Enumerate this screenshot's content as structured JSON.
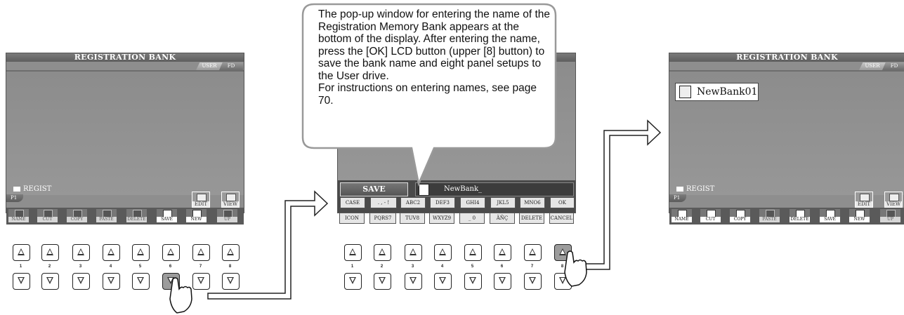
{
  "left_screen": {
    "title": "REGISTRATION BANK",
    "tabs": [
      "USER",
      "FD"
    ],
    "active_tab": "USER",
    "folder": "REGIST",
    "page": "P1",
    "side_buttons": [
      "EDIT",
      "VIEW"
    ],
    "function_buttons": [
      "NAME",
      "CUT",
      "COPY",
      "PASTE",
      "DELETE",
      "SAVE",
      "NEW",
      "UP"
    ],
    "highlighted": "SAVE"
  },
  "middle_screen": {
    "save_label": "SAVE",
    "name_value": "NewBank_",
    "keys_top": [
      "CASE",
      ". , - !",
      "ABC2",
      "DEF3",
      "GHI4",
      "JKL5",
      "MNO6",
      "OK"
    ],
    "keys_bottom": [
      "ICON",
      "PQRS7",
      "TUV8",
      "WXYZ9",
      "_ 0",
      "ÄÑÇ",
      "DELETE",
      "CANCEL"
    ]
  },
  "right_screen": {
    "title": "REGISTRATION BANK",
    "tabs": [
      "USER",
      "FD"
    ],
    "active_tab": "USER",
    "file_name": "NewBank01",
    "folder": "REGIST",
    "page": "P1",
    "side_buttons": [
      "EDIT",
      "VIEW"
    ],
    "function_buttons": [
      "NAME",
      "CUT",
      "COPY",
      "PASTE",
      "DELETE",
      "SAVE",
      "NEW",
      "UP"
    ]
  },
  "callout": {
    "text": "The pop-up window for entering the name of the Registration Memory Bank appears at the bottom of the display. After entering the name, press the [OK] LCD button (upper [8] button) to save the bank name and eight panel setups to the User drive.\nFor instructions on entering names, see page 70."
  },
  "hardware": {
    "numbers": [
      "1",
      "2",
      "3",
      "4",
      "5",
      "6",
      "7",
      "8"
    ]
  },
  "icons": [
    "folder-icon",
    "file-icon",
    "hand-pointer-icon",
    "arrow-icon",
    "scissors-icon",
    "trash-icon",
    "floppy-icon"
  ]
}
